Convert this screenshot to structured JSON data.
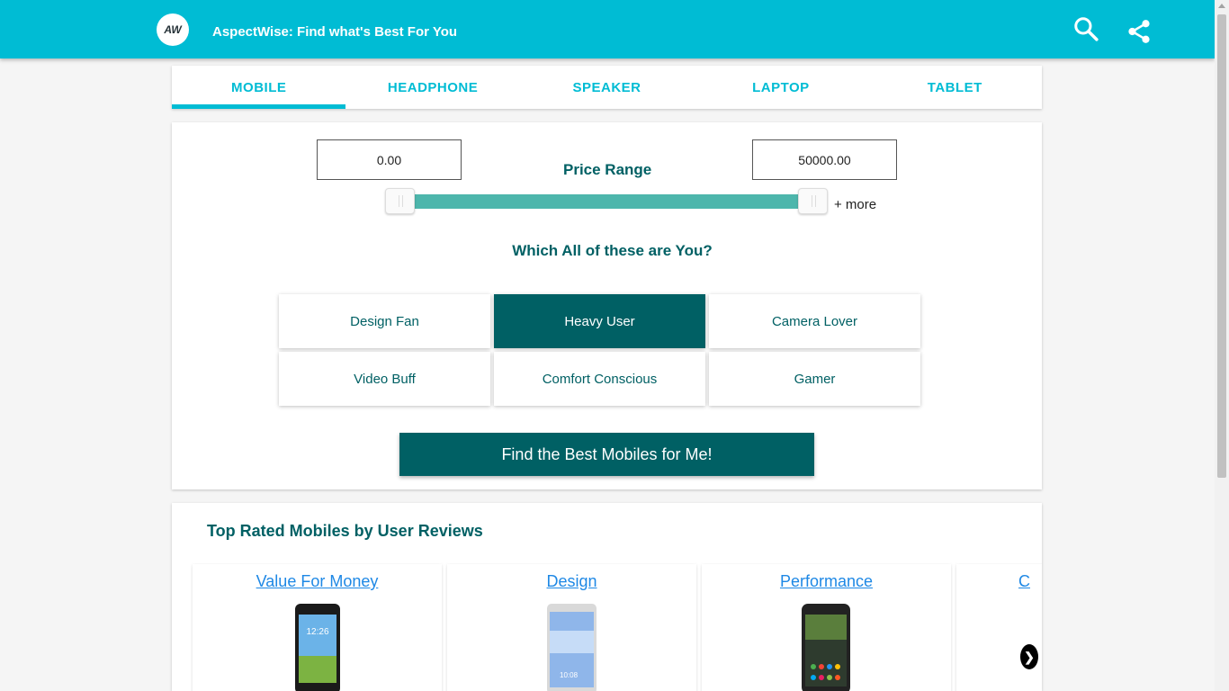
{
  "header": {
    "logo_text": "AW",
    "title": "AspectWise: Find what's Best For You",
    "search_icon": "search-icon",
    "share_icon": "share-icon",
    "bar_color": "#00bcd4"
  },
  "tabs": [
    {
      "label": "MOBILE",
      "active": true
    },
    {
      "label": "HEADPHONE",
      "active": false
    },
    {
      "label": "SPEAKER",
      "active": false
    },
    {
      "label": "LAPTOP",
      "active": false
    },
    {
      "label": "TABLET",
      "active": false
    }
  ],
  "filters": {
    "min_price": "0.00",
    "max_price": "50000.00",
    "price_label": "Price Range",
    "more_label": "+ more",
    "question": "Which All of these are You?",
    "personas": [
      {
        "label": "Design Fan",
        "selected": false
      },
      {
        "label": "Heavy User",
        "selected": true
      },
      {
        "label": "Camera Lover",
        "selected": false
      },
      {
        "label": "Video Buff",
        "selected": false
      },
      {
        "label": "Comfort Conscious",
        "selected": false
      },
      {
        "label": "Gamer",
        "selected": false
      }
    ],
    "cta_label": "Find the Best Mobiles for Me!",
    "accent": "#006064",
    "slider_color": "#4db6ac"
  },
  "top_rated": {
    "title": "Top Rated Mobiles by User Reviews",
    "categories": [
      {
        "label": "Value For Money"
      },
      {
        "label": "Design"
      },
      {
        "label": "Performance"
      },
      {
        "label": "C"
      }
    ],
    "next_icon": "chevron-right-icon"
  }
}
